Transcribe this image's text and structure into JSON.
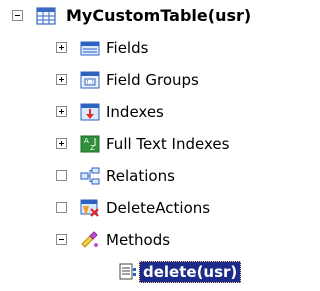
{
  "tree": {
    "root": {
      "label": "MyCustomTable(usr)",
      "expander": "minus",
      "icon": "table-icon"
    },
    "children": [
      {
        "label": "Fields",
        "expander": "plus",
        "icon": "fields-icon"
      },
      {
        "label": "Field Groups",
        "expander": "plus",
        "icon": "field-groups-icon"
      },
      {
        "label": "Indexes",
        "expander": "plus",
        "icon": "indexes-icon"
      },
      {
        "label": "Full Text Indexes",
        "expander": "plus",
        "icon": "full-text-indexes-icon"
      },
      {
        "label": "Relations",
        "expander": "empty",
        "icon": "relations-icon"
      },
      {
        "label": "DeleteActions",
        "expander": "empty",
        "icon": "delete-actions-icon"
      },
      {
        "label": "Methods",
        "expander": "minus",
        "icon": "methods-icon"
      }
    ],
    "methods": [
      {
        "label": "delete(usr)",
        "icon": "method-icon",
        "selected": true
      }
    ]
  }
}
